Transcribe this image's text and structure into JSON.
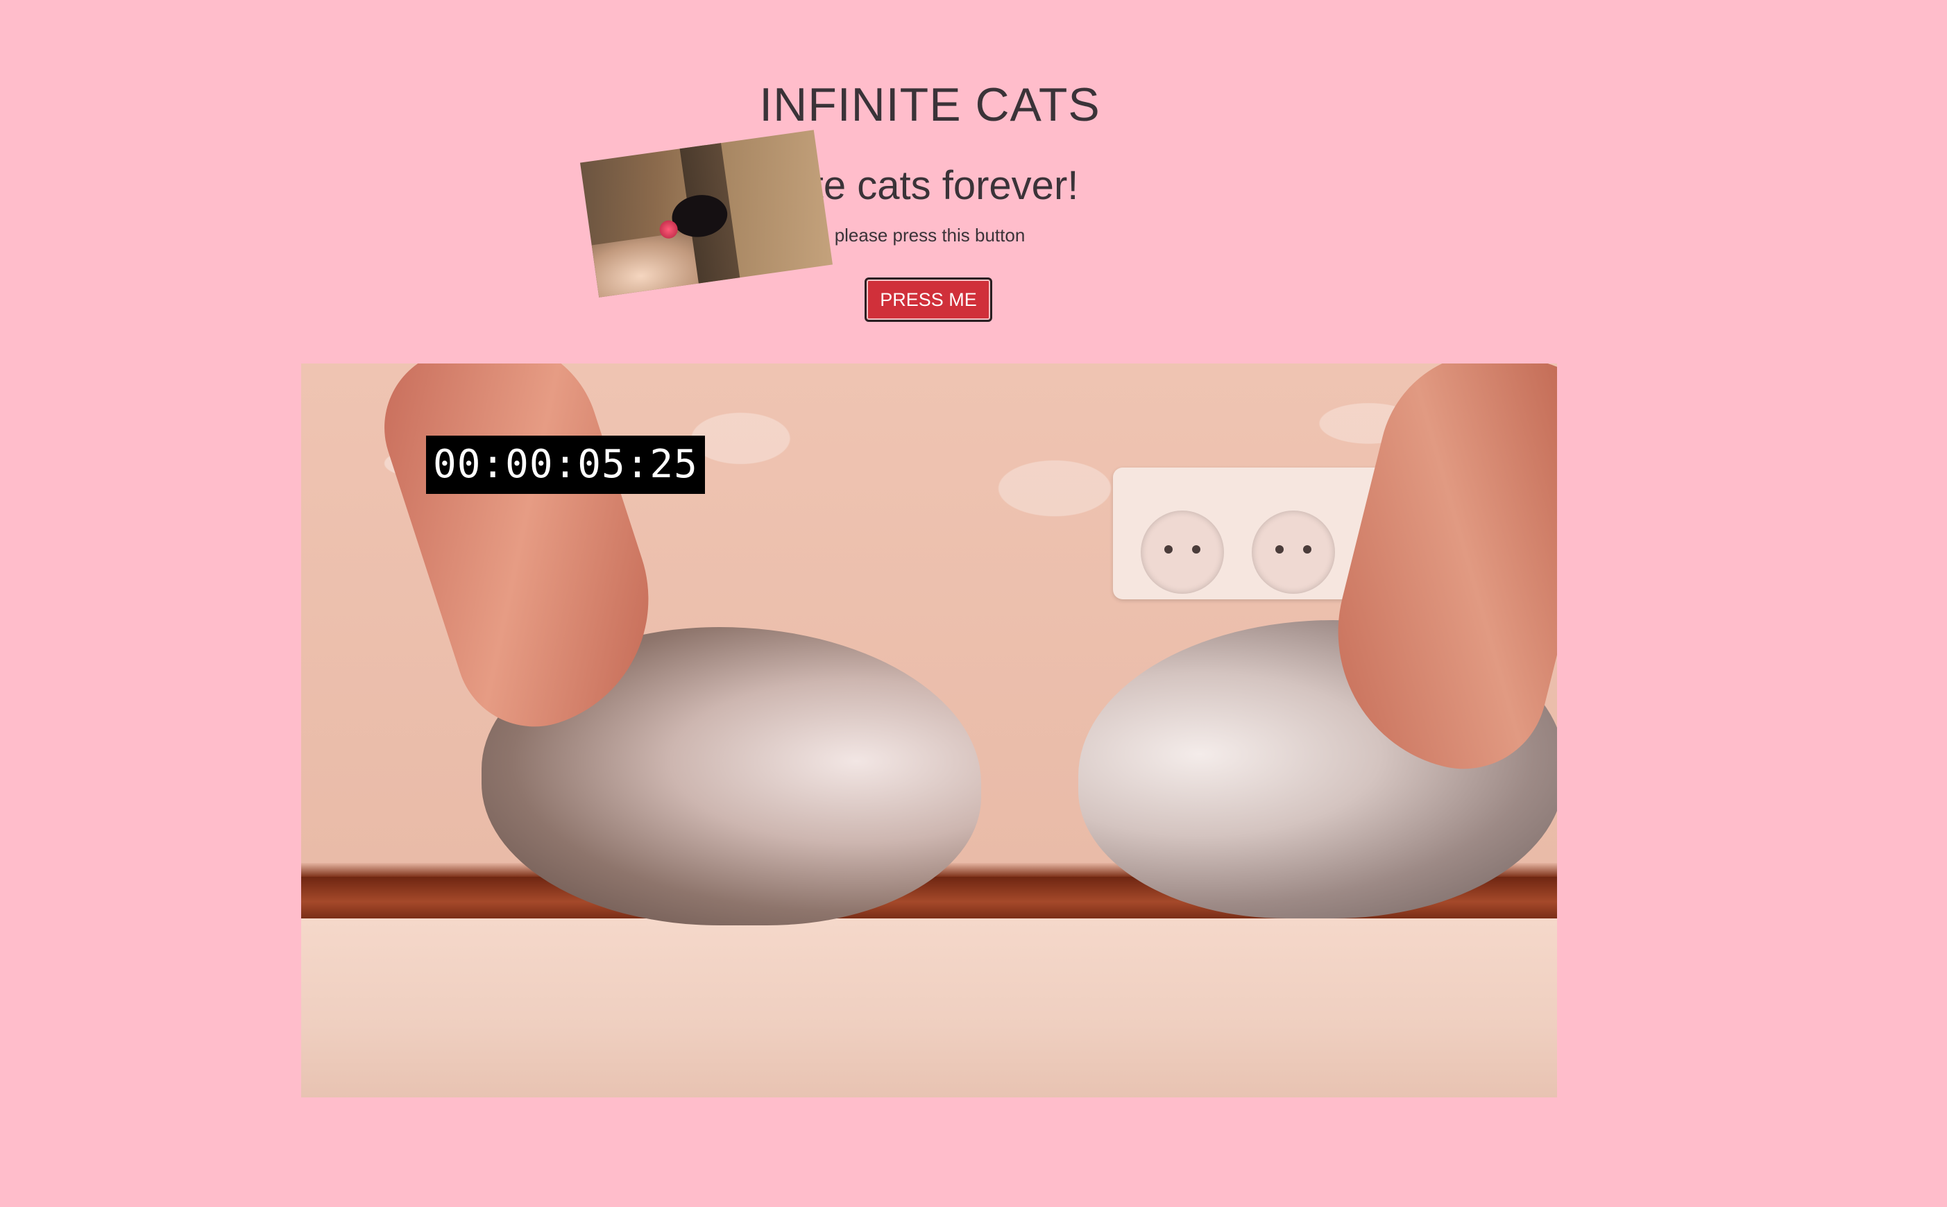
{
  "page": {
    "title": "INFINITE CATS",
    "subtitle": "nite cats forever!",
    "instruction": "please press this button",
    "button_label": "PRESS ME"
  },
  "video": {
    "timecode": "00:00:05:25"
  },
  "colors": {
    "background": "#ffbdcb",
    "button": "#d0303a",
    "text": "#3a3338"
  }
}
